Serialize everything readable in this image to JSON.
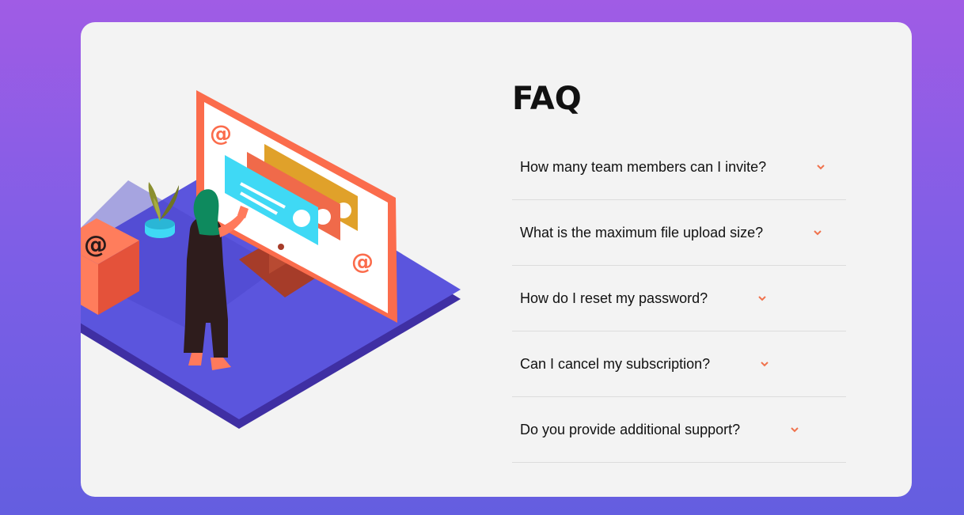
{
  "faq": {
    "title": "FAQ",
    "items": [
      {
        "question": "How many team members can I invite?"
      },
      {
        "question": "What is the maximum file upload size?"
      },
      {
        "question": "How do I reset my password?"
      },
      {
        "question": "Can I cancel my subscription?"
      },
      {
        "question": "Do you provide additional support?"
      }
    ]
  },
  "colors": {
    "accent": "#f0724d",
    "platform": "#5b55dd",
    "screen_frame": "#fb6c4c",
    "background_top": "#a05ce5",
    "background_bottom": "#645ee0"
  },
  "icons": {
    "item_chevron": "chevron-down-icon",
    "at_symbol": "at-sign-icon"
  }
}
